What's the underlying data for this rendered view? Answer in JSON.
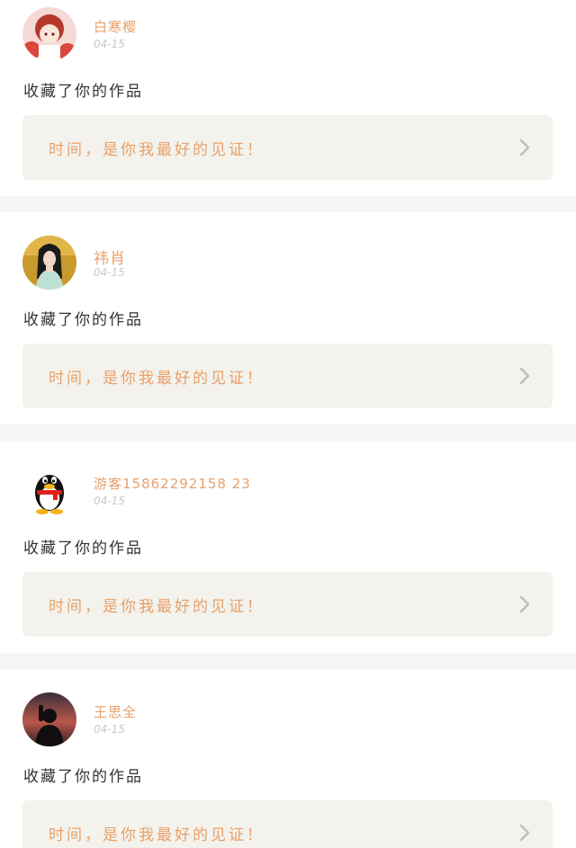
{
  "feed": {
    "items": [
      {
        "user_name": "白寒樱",
        "date": "04-15",
        "action": "收藏了你的作品",
        "work_title": "时间，是你我最好的见证！",
        "avatar_icon": "anime-girl-avatar-icon"
      },
      {
        "user_name": "祎肖",
        "date": "04-15",
        "action": "收藏了你的作品",
        "work_title": "时间，是你我最好的见证！",
        "avatar_icon": "hanfu-portrait-avatar-icon"
      },
      {
        "user_name": "游客15862292158 23",
        "date": "04-15",
        "action": "收藏了你的作品",
        "work_title": "时间，是你我最好的见证！",
        "avatar_icon": "qq-penguin-avatar-icon"
      },
      {
        "user_name": "王思全",
        "date": "04-15",
        "action": "收藏了你的作品",
        "work_title": "时间，是你我最好的见证！",
        "avatar_icon": "sunset-silhouette-avatar-icon"
      }
    ]
  },
  "colors": {
    "accent": "#e8a06a",
    "card_bg": "#f3f2ec",
    "separator": "#f5f5f5",
    "date": "#c9c9c9",
    "text": "#333333"
  }
}
